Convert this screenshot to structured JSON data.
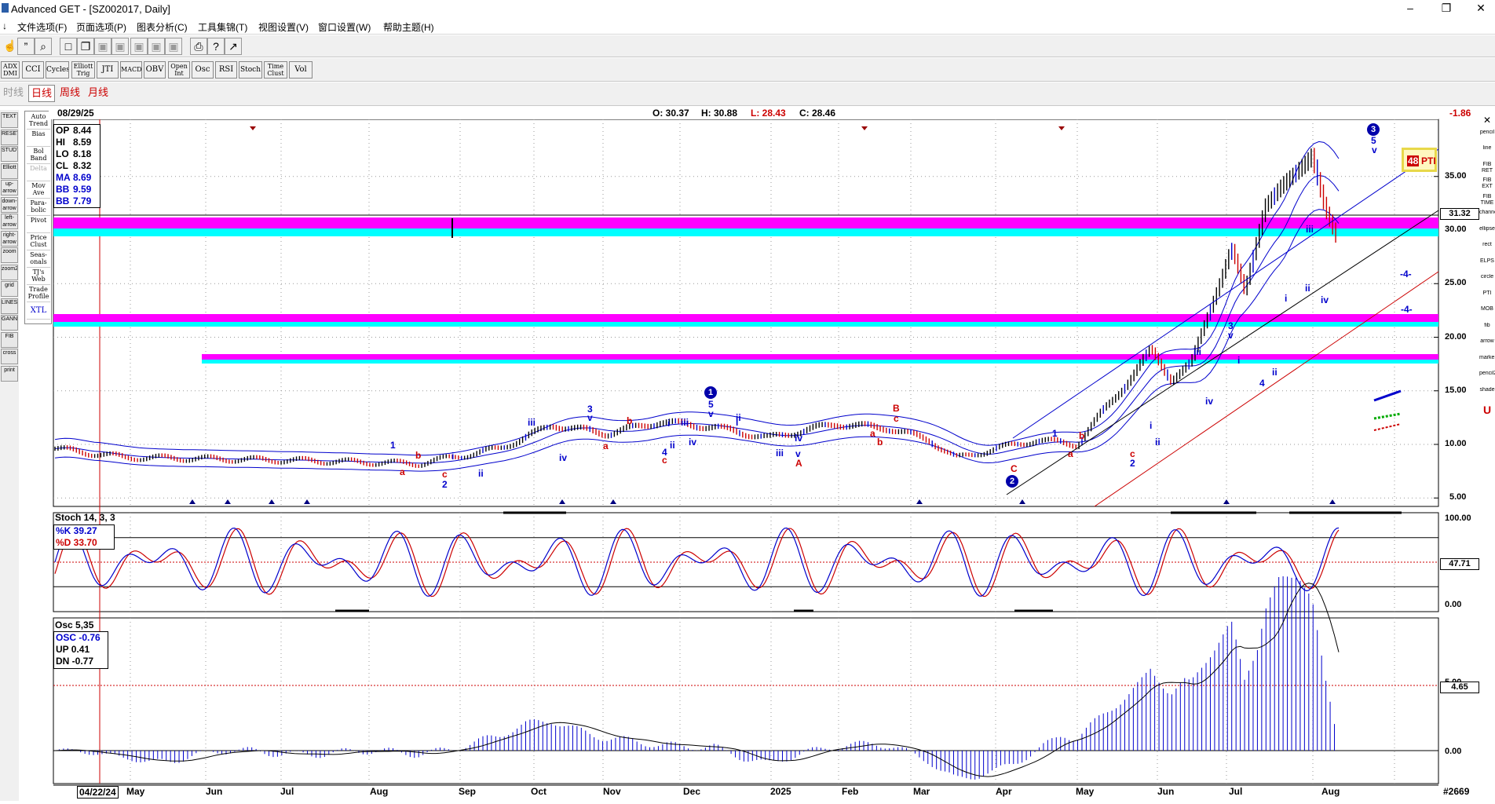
{
  "window": {
    "title": "Advanced GET - [SZ002017, Daily]",
    "min": "–",
    "restore": "❐",
    "close": "✕"
  },
  "menu": [
    "文件选项(F)",
    "页面选项(P)",
    "图表分析(C)",
    "工具集锦(T)",
    "视图设置(V)",
    "窗口设置(W)",
    "帮助主题(H)"
  ],
  "toolbar2": [
    "ADX DMI",
    "CCI",
    "Cycles",
    "Elliott Trig",
    "JTI",
    "MACD",
    "OBV",
    "Open Int",
    "Osc",
    "RSI",
    "Stoch",
    "Time Clust",
    "Vol"
  ],
  "periods": [
    "时线",
    "日线",
    "周线",
    "月线"
  ],
  "studies": [
    "Auto Trend",
    "Bias",
    "Bol Band",
    "Delta",
    "Mov Ave",
    "Para-bolic",
    "Pivot",
    "Price Clust",
    "Seas-onals",
    "TJ's Web",
    "Trade Profile",
    "XTL"
  ],
  "left_icons": [
    "TEXT",
    "RESET",
    "STUDY",
    "Elliott",
    "up-arrow",
    "down-arrow",
    "left-arrow",
    "right-arrow",
    "zoom",
    "zoom2",
    "grid",
    "LINES",
    "GANN",
    "FIB",
    "cross",
    "print"
  ],
  "right_icons": [
    "✕",
    "pencil",
    "line",
    "FIB RET",
    "FIB EXT",
    "FIB TIME",
    "channel",
    "ellipse",
    "rect",
    "ELPS",
    "circle",
    "PTI",
    "MOB",
    "fib",
    "arrow",
    "marker",
    "pencil2",
    "shade",
    "U"
  ],
  "header": {
    "date": "08/29/25",
    "ohlc": {
      "o": "O: 30.37",
      "h": "H: 30.88",
      "l": "L: 28.43",
      "c": "C: 28.46"
    },
    "change": "-1.86"
  },
  "info_box": [
    {
      "label": "OP",
      "value": "8.44",
      "color": "#000000"
    },
    {
      "label": "HI",
      "value": "8.59",
      "color": "#000000"
    },
    {
      "label": "LO",
      "value": "8.18",
      "color": "#000000"
    },
    {
      "label": "CL",
      "value": "8.32",
      "color": "#000000"
    },
    {
      "label": "MA",
      "value": "8.69",
      "color": "#0000cc"
    },
    {
      "label": "BB",
      "value": "9.59",
      "color": "#0000cc"
    },
    {
      "label": "BB",
      "value": "7.79",
      "color": "#0000cc"
    }
  ],
  "price_axis": [
    "35.00",
    "30.00",
    "25.00",
    "20.00",
    "15.00",
    "10.00",
    "5.00"
  ],
  "price_current": "31.32",
  "pti": {
    "value": "48",
    "label": "PTI"
  },
  "stoch": {
    "title": "Stoch 14, 3, 3",
    "k": "%K 39.27",
    "d": "%D 33.70",
    "axis": [
      "100.00",
      "0.00"
    ],
    "current": "47.71"
  },
  "osc": {
    "title": "Osc 5,35",
    "osc": "OSC -0.76",
    "up": "UP  0.41",
    "dn": "DN  -0.77",
    "axis": [
      "5.00",
      "0.00"
    ],
    "current": "4.65"
  },
  "dates": [
    "04/22/24",
    "May",
    "Jun",
    "Jul",
    "Aug",
    "Sep",
    "Oct",
    "Nov",
    "Dec",
    "2025",
    "Feb",
    "Mar",
    "Apr",
    "May",
    "Jun",
    "Jul",
    "Aug"
  ],
  "bar_count": "#2669",
  "elliott_labels": [
    {
      "t": "1",
      "c": "#0000cc"
    },
    {
      "t": "b",
      "c": "#cc0000"
    },
    {
      "t": "a",
      "c": "#cc0000"
    },
    {
      "t": "i",
      "c": "#0000cc"
    },
    {
      "t": "c",
      "c": "#cc0000"
    },
    {
      "t": "2",
      "c": "#0000cc"
    },
    {
      "t": "ii",
      "c": "#0000cc"
    },
    {
      "t": "iii",
      "c": "#0000cc"
    },
    {
      "t": "iv",
      "c": "#0000cc"
    },
    {
      "t": "a",
      "c": "#cc0000"
    },
    {
      "t": "3",
      "c": "#0000cc"
    },
    {
      "t": "v",
      "c": "#0000cc"
    },
    {
      "t": "b",
      "c": "#cc0000"
    },
    {
      "t": "4",
      "c": "#0000cc"
    },
    {
      "t": "c",
      "c": "#cc0000"
    },
    {
      "t": "ii",
      "c": "#0000cc"
    },
    {
      "t": "i",
      "c": "#0000cc"
    },
    {
      "t": "iii",
      "c": "#0000cc"
    },
    {
      "t": "iv",
      "c": "#0000cc"
    },
    {
      "t": "5",
      "c": "#0000cc"
    },
    {
      "t": "v",
      "c": "#0000cc"
    },
    {
      "t": "ii",
      "c": "#0000cc"
    },
    {
      "t": "i",
      "c": "#0000cc"
    },
    {
      "t": "iii",
      "c": "#0000cc"
    },
    {
      "t": "iv",
      "c": "#0000cc"
    },
    {
      "t": "v",
      "c": "#0000cc"
    },
    {
      "t": "A",
      "c": "#cc0000"
    },
    {
      "t": "a",
      "c": "#cc0000"
    },
    {
      "t": "B",
      "c": "#cc0000"
    },
    {
      "t": "c",
      "c": "#cc0000"
    },
    {
      "t": "b",
      "c": "#cc0000"
    },
    {
      "t": "C",
      "c": "#cc0000"
    },
    {
      "t": "1",
      "c": "#0000cc"
    },
    {
      "t": "b",
      "c": "#cc0000"
    },
    {
      "t": "a",
      "c": "#cc0000"
    },
    {
      "t": "c",
      "c": "#cc0000"
    },
    {
      "t": "2",
      "c": "#0000cc"
    },
    {
      "t": "i",
      "c": "#0000cc"
    },
    {
      "t": "ii",
      "c": "#0000cc"
    },
    {
      "t": "iii",
      "c": "#0000cc"
    },
    {
      "t": "iv",
      "c": "#0000cc"
    },
    {
      "t": "3",
      "c": "#0000cc"
    },
    {
      "t": "v",
      "c": "#0000cc"
    },
    {
      "t": "i",
      "c": "#0000cc"
    },
    {
      "t": "ii",
      "c": "#0000cc"
    },
    {
      "t": "4",
      "c": "#0000cc"
    },
    {
      "t": "i",
      "c": "#0000cc"
    },
    {
      "t": "ii",
      "c": "#0000cc"
    },
    {
      "t": "iii",
      "c": "#0000cc"
    },
    {
      "t": "iv",
      "c": "#0000cc"
    },
    {
      "t": "5",
      "c": "#0000cc"
    },
    {
      "t": "v",
      "c": "#0000cc"
    },
    {
      "t": "-4-",
      "c": "#0000cc"
    },
    {
      "t": "-4-",
      "c": "#0000cc"
    }
  ],
  "wave_circles": [
    "1",
    "2",
    "3"
  ]
}
